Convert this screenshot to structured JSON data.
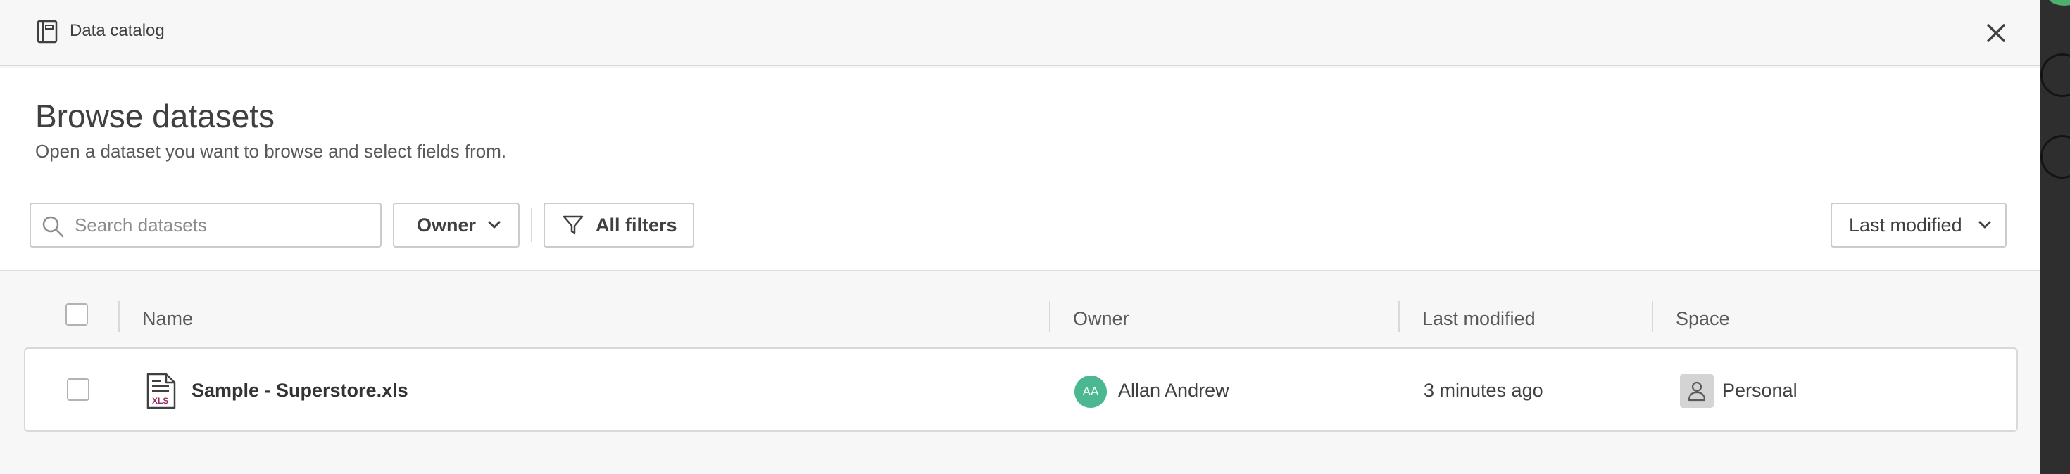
{
  "header": {
    "title": "Data catalog",
    "icon": "book-icon",
    "close_icon": "close-icon"
  },
  "main": {
    "heading": "Browse datasets",
    "subtitle": "Open a dataset you want to browse and select fields from."
  },
  "toolbar": {
    "search_placeholder": "Search datasets",
    "owner_label": "Owner",
    "filters_label": "All filters",
    "sort_label": "Last modified"
  },
  "table": {
    "columns": [
      "Name",
      "Owner",
      "Last modified",
      "Space"
    ],
    "rows": [
      {
        "name": "Sample - Superstore.xls",
        "file_type": "XLS",
        "owner_initials": "AA",
        "owner": "Allan Andrew",
        "last_modified": "3 minutes ago",
        "space": "Personal"
      }
    ]
  },
  "colors": {
    "avatar": "#4bb891",
    "xls_badge": "#9b2b66"
  }
}
